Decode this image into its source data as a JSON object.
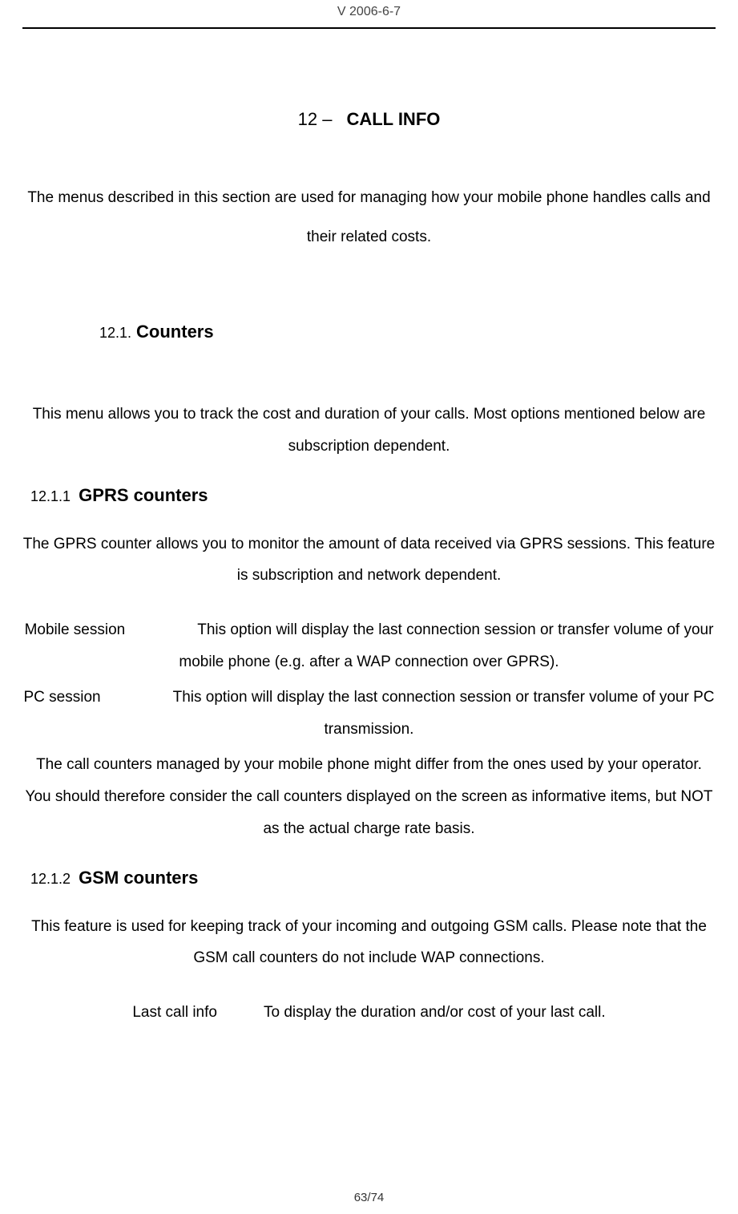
{
  "header": {
    "version": "V 2006-6-7"
  },
  "section": {
    "number": "12 –",
    "title": "CALL INFO",
    "intro": "The menus described in this section are used for managing how your mobile phone handles calls and their related costs."
  },
  "subsection1": {
    "number": "12.1.",
    "title": "Counters",
    "intro": "This menu allows you to track the cost and duration of your calls. Most options mentioned below are subscription dependent."
  },
  "gprs": {
    "number": "12.1.1",
    "title": "GPRS counters",
    "intro": "The GPRS counter allows you to monitor the amount of data received via GPRS sessions. This feature is subscription and network dependent.",
    "mobile_term": "Mobile session",
    "mobile_desc": "This option will display the last connection session or transfer volume of your mobile phone (e.g. after a WAP connection over GPRS).",
    "pc_term": "PC session",
    "pc_desc": "This option will display the last connection session or transfer volume of your PC transmission.",
    "disclaimer": "The call counters managed by your mobile phone might differ from the ones used by your operator. You should therefore consider the call counters displayed on the screen as informative items, but NOT as the actual charge rate basis."
  },
  "gsm": {
    "number": "12.1.2",
    "title": "GSM counters",
    "intro": "This feature is used for keeping track of your incoming and outgoing GSM calls. Please note that the GSM call counters do not include WAP connections.",
    "lastcall_term": "Last call info",
    "lastcall_desc": "To display the duration and/or cost of your last call."
  },
  "footer": {
    "page": "63/74"
  }
}
